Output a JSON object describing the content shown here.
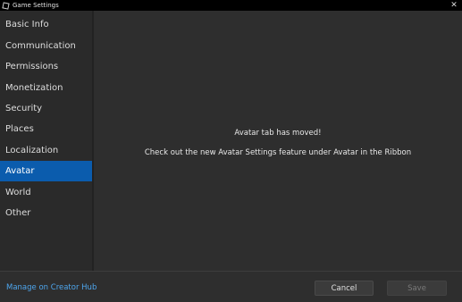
{
  "window": {
    "title": "Game Settings",
    "close_glyph": "✕"
  },
  "sidebar": {
    "items": [
      {
        "label": "Basic Info",
        "selected": false
      },
      {
        "label": "Communication",
        "selected": false
      },
      {
        "label": "Permissions",
        "selected": false
      },
      {
        "label": "Monetization",
        "selected": false
      },
      {
        "label": "Security",
        "selected": false
      },
      {
        "label": "Places",
        "selected": false
      },
      {
        "label": "Localization",
        "selected": false
      },
      {
        "label": "Avatar",
        "selected": true
      },
      {
        "label": "World",
        "selected": false
      },
      {
        "label": "Other",
        "selected": false
      }
    ]
  },
  "main": {
    "heading": "Avatar tab has moved!",
    "message": "Check out the new Avatar Settings feature under Avatar in the Ribbon"
  },
  "footer": {
    "hub_link": "Manage on Creator Hub",
    "cancel_label": "Cancel",
    "save_label": "Save"
  },
  "colors": {
    "accent": "#0b5cad",
    "link": "#4ea6ee",
    "background": "#2e2e2e",
    "sidebar": "#2a2a2a",
    "titlebar": "#000000"
  }
}
